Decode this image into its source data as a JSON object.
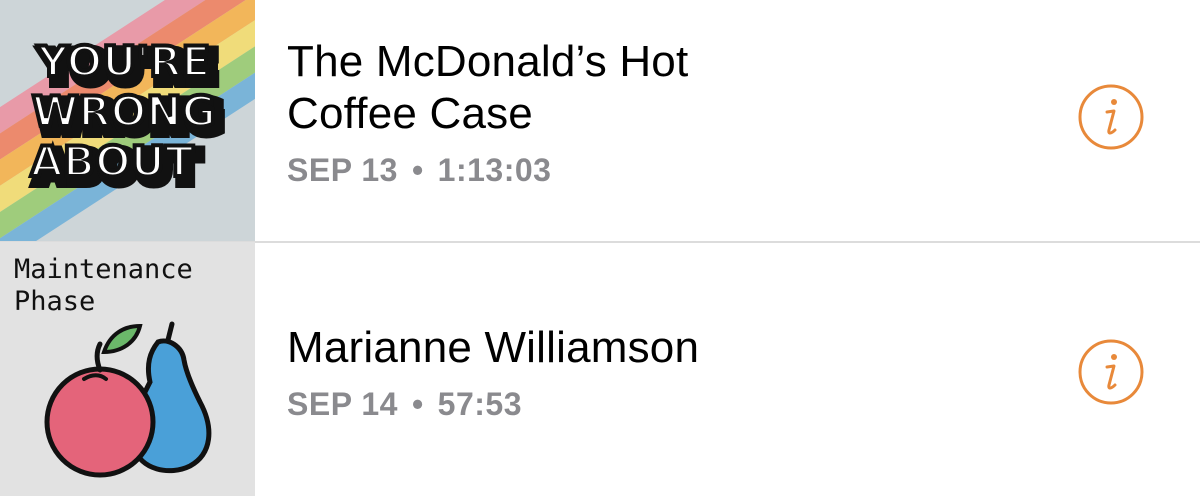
{
  "episodes": [
    {
      "podcast_art_text": [
        "YOU'RE",
        "WRONG",
        "ABOUT"
      ],
      "title_lines": [
        "The McDonald’s Hot",
        "Coffee Case"
      ],
      "date": "SEP 13",
      "duration": "1:13:03",
      "info_icon": "info-circle-icon"
    },
    {
      "podcast_art_text": [
        "Maintenance",
        "Phase"
      ],
      "title_lines": [
        "Marianne Williamson"
      ],
      "date": "SEP 14",
      "duration": "57:53",
      "info_icon": "info-circle-icon"
    }
  ],
  "separator": "•",
  "colors": {
    "accent": "#e8893a",
    "meta_text": "#8a8a8e",
    "divider": "#dcdcdc"
  }
}
